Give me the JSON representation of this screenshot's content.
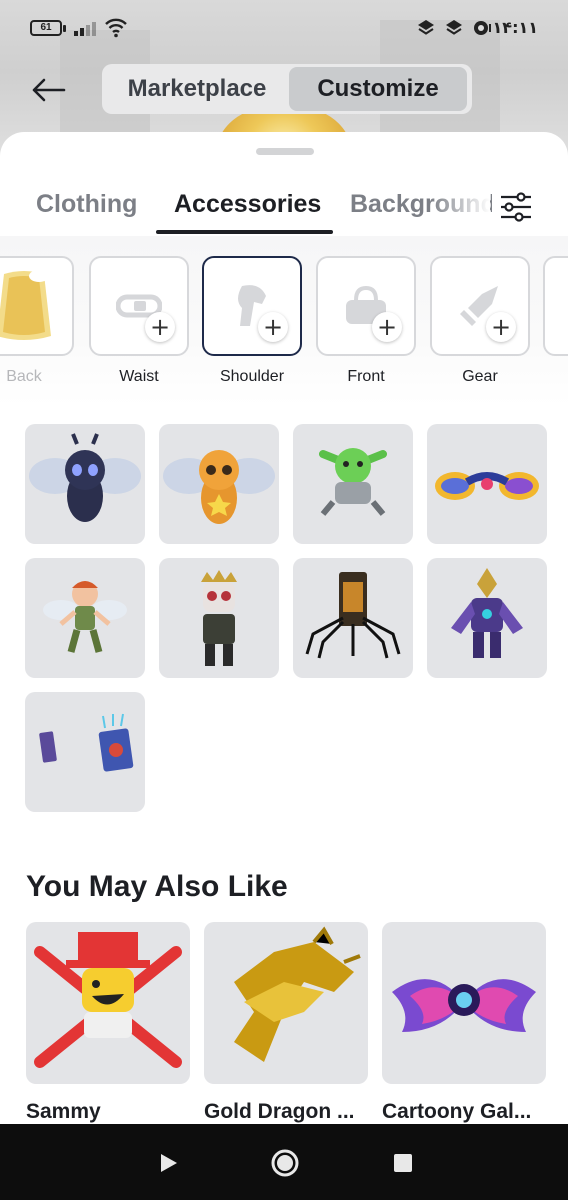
{
  "status_bar": {
    "battery": "61",
    "time": "۱۴:۱۱",
    "icons": [
      "signal-icon",
      "wifi-icon",
      "layers-icon",
      "layers-icon",
      "timer-icon"
    ]
  },
  "header": {
    "back_icon": "arrow-left-icon",
    "segments": [
      {
        "label": "Marketplace",
        "selected": false
      },
      {
        "label": "Customize",
        "selected": true
      }
    ]
  },
  "tabs": {
    "items": [
      {
        "label": "Clothing",
        "active": false
      },
      {
        "label": "Accessories",
        "active": true
      },
      {
        "label": "Background",
        "active": false
      }
    ],
    "filter_icon": "sliders-icon"
  },
  "categories": [
    {
      "label": "Back",
      "icon": "cape-icon",
      "selected": false
    },
    {
      "label": "Waist",
      "icon": "belt-icon",
      "selected": false
    },
    {
      "label": "Shoulder",
      "icon": "shoulder-pet-icon",
      "selected": true
    },
    {
      "label": "Front",
      "icon": "bag-icon",
      "selected": false
    },
    {
      "label": "Gear",
      "icon": "sword-icon",
      "selected": false
    }
  ],
  "accessory_items": [
    {
      "icon": "dark-bee-icon"
    },
    {
      "icon": "orange-bee-icon"
    },
    {
      "icon": "green-goblin-icon"
    },
    {
      "icon": "rainbow-dragons-icon"
    },
    {
      "icon": "fairy-boy-icon"
    },
    {
      "icon": "crowned-kid-icon"
    },
    {
      "icon": "spider-can-icon"
    },
    {
      "icon": "purple-armor-icon"
    },
    {
      "icon": "spell-books-icon"
    }
  ],
  "recommendations": {
    "title": "You May Also Like",
    "items": [
      {
        "name": "Sammy",
        "icon": "sammy-icon"
      },
      {
        "name": "Gold Dragon ...",
        "icon": "gold-dragon-icon"
      },
      {
        "name": "Cartoony Gal...",
        "icon": "galaxy-wings-icon"
      }
    ]
  },
  "nav_bar": {
    "icons": [
      "back-triangle-icon",
      "home-circle-icon",
      "recents-square-icon"
    ]
  },
  "colors": {
    "accent_dark": "#1e2a4a",
    "tile_bg": "#e3e4e7",
    "text": "#1d1f24",
    "muted": "#7c7f86"
  }
}
